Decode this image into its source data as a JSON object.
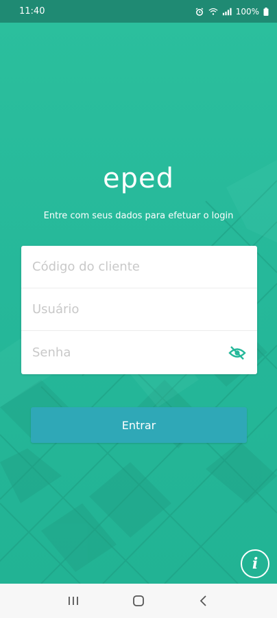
{
  "status_bar": {
    "time": "11:40",
    "battery": "100%"
  },
  "app": {
    "logo_text": "eped",
    "subtitle": "Entre com seus dados para efetuar o login"
  },
  "form": {
    "client_code_placeholder": "Código do cliente",
    "user_placeholder": "Usuário",
    "password_placeholder": "Senha"
  },
  "actions": {
    "login_label": "Entrar",
    "info_label": "i"
  },
  "colors": {
    "background": "#26b89a",
    "status_bar": "#1f8a73",
    "button": "#2fa8b7",
    "eye_icon": "#26b89a"
  }
}
